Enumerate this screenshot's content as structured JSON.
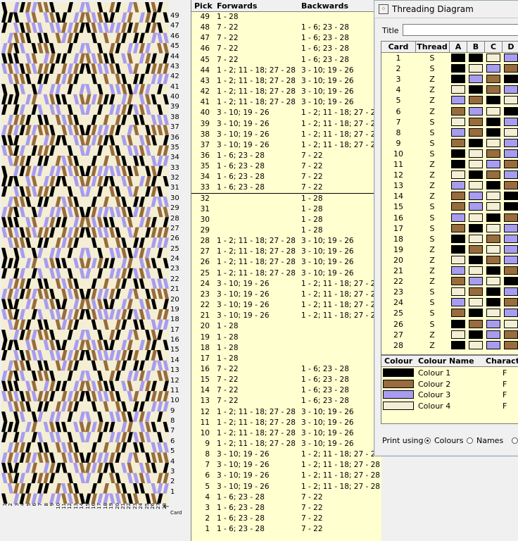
{
  "colours": {
    "c1": "#000000",
    "c2": "#986c3c",
    "c3": "#a89cf0",
    "c4": "#f4efd4"
  },
  "pattern": {
    "pick_ticks": [
      "49",
      "47",
      "46",
      "45",
      "44",
      "43",
      "42",
      "41",
      "40",
      "39",
      "38",
      "37",
      "36",
      "35",
      "34",
      "33",
      "32",
      "31",
      "30",
      "29",
      "28",
      "27",
      "26",
      "25",
      "24",
      "23",
      "22",
      "21",
      "20",
      "19",
      "18",
      "17",
      "16",
      "15",
      "14",
      "13",
      "12",
      "11",
      "10",
      "9",
      "8",
      "7",
      "6",
      "5",
      "4",
      "3",
      "2",
      "1"
    ],
    "card_ticks": [
      "1",
      "2",
      "3",
      "4",
      "5",
      "6",
      "7",
      "8",
      "9",
      "10",
      "11",
      "12",
      "13",
      "14",
      "15",
      "16",
      "17",
      "18",
      "19",
      "20",
      "21",
      "22",
      "23",
      "24",
      "25",
      "26",
      "27",
      "28"
    ],
    "card_label": "Card"
  },
  "schedule": {
    "headers": {
      "pick": "Pick",
      "forwards": "Forwards",
      "backwards": "Backwards"
    },
    "rows": [
      {
        "p": "49",
        "f": "1 - 28",
        "b": ""
      },
      {
        "p": "48",
        "f": "7 - 22",
        "b": "1 - 6; 23 - 28"
      },
      {
        "p": "47",
        "f": "7 - 22",
        "b": "1 - 6; 23 - 28"
      },
      {
        "p": "46",
        "f": "7 - 22",
        "b": "1 - 6; 23 - 28"
      },
      {
        "p": "45",
        "f": "7 - 22",
        "b": "1 - 6; 23 - 28"
      },
      {
        "p": "44",
        "f": "1 - 2; 11 - 18; 27 - 28",
        "b": "3 - 10; 19 - 26"
      },
      {
        "p": "43",
        "f": "1 - 2; 11 - 18; 27 - 28",
        "b": "3 - 10; 19 - 26"
      },
      {
        "p": "42",
        "f": "1 - 2; 11 - 18; 27 - 28",
        "b": "3 - 10; 19 - 26"
      },
      {
        "p": "41",
        "f": "1 - 2; 11 - 18; 27 - 28",
        "b": "3 - 10; 19 - 26"
      },
      {
        "p": "40",
        "f": "3 - 10; 19 - 26",
        "b": "1 - 2; 11 - 18; 27 - 28"
      },
      {
        "p": "39",
        "f": "3 - 10; 19 - 26",
        "b": "1 - 2; 11 - 18; 27 - 28"
      },
      {
        "p": "38",
        "f": "3 - 10; 19 - 26",
        "b": "1 - 2; 11 - 18; 27 - 28"
      },
      {
        "p": "37",
        "f": "3 - 10; 19 - 26",
        "b": "1 - 2; 11 - 18; 27 - 28"
      },
      {
        "p": "36",
        "f": "1 - 6; 23 - 28",
        "b": "7 - 22"
      },
      {
        "p": "35",
        "f": "1 - 6; 23 - 28",
        "b": "7 - 22"
      },
      {
        "p": "34",
        "f": "1 - 6; 23 - 28",
        "b": "7 - 22"
      },
      {
        "p": "33",
        "f": "1 - 6; 23 - 28",
        "b": "7 - 22"
      },
      {
        "p": "32",
        "f": "",
        "b": "1 - 28"
      },
      {
        "p": "31",
        "f": "",
        "b": "1 - 28"
      },
      {
        "p": "30",
        "f": "",
        "b": "1 - 28"
      },
      {
        "p": "29",
        "f": "",
        "b": "1 - 28"
      },
      {
        "p": "28",
        "f": "1 - 2; 11 - 18; 27 - 28",
        "b": "3 - 10; 19 - 26"
      },
      {
        "p": "27",
        "f": "1 - 2; 11 - 18; 27 - 28",
        "b": "3 - 10; 19 - 26"
      },
      {
        "p": "26",
        "f": "1 - 2; 11 - 18; 27 - 28",
        "b": "3 - 10; 19 - 26"
      },
      {
        "p": "25",
        "f": "1 - 2; 11 - 18; 27 - 28",
        "b": "3 - 10; 19 - 26"
      },
      {
        "p": "24",
        "f": "3 - 10; 19 - 26",
        "b": "1 - 2; 11 - 18; 27 - 28"
      },
      {
        "p": "23",
        "f": "3 - 10; 19 - 26",
        "b": "1 - 2; 11 - 18; 27 - 28"
      },
      {
        "p": "22",
        "f": "3 - 10; 19 - 26",
        "b": "1 - 2; 11 - 18; 27 - 28"
      },
      {
        "p": "21",
        "f": "3 - 10; 19 - 26",
        "b": "1 - 2; 11 - 18; 27 - 28"
      },
      {
        "p": "20",
        "f": "1 - 28",
        "b": ""
      },
      {
        "p": "19",
        "f": "1 - 28",
        "b": ""
      },
      {
        "p": "18",
        "f": "1 - 28",
        "b": ""
      },
      {
        "p": "17",
        "f": "1 - 28",
        "b": ""
      },
      {
        "p": "16",
        "f": "7 - 22",
        "b": "1 - 6; 23 - 28"
      },
      {
        "p": "15",
        "f": "7 - 22",
        "b": "1 - 6; 23 - 28"
      },
      {
        "p": "14",
        "f": "7 - 22",
        "b": "1 - 6; 23 - 28"
      },
      {
        "p": "13",
        "f": "7 - 22",
        "b": "1 - 6; 23 - 28"
      },
      {
        "p": "12",
        "f": "1 - 2; 11 - 18; 27 - 28",
        "b": "3 - 10; 19 - 26"
      },
      {
        "p": "11",
        "f": "1 - 2; 11 - 18; 27 - 28",
        "b": "3 - 10; 19 - 26"
      },
      {
        "p": "10",
        "f": "1 - 2; 11 - 18; 27 - 28",
        "b": "3 - 10; 19 - 26"
      },
      {
        "p": "9",
        "f": "1 - 2; 11 - 18; 27 - 28",
        "b": "3 - 10; 19 - 26"
      },
      {
        "p": "8",
        "f": "3 - 10; 19 - 26",
        "b": "1 - 2; 11 - 18; 27 - 28"
      },
      {
        "p": "7",
        "f": "3 - 10; 19 - 26",
        "b": "1 - 2; 11 - 18; 27 - 28"
      },
      {
        "p": "6",
        "f": "3 - 10; 19 - 26",
        "b": "1 - 2; 11 - 18; 27 - 28"
      },
      {
        "p": "5",
        "f": "3 - 10; 19 - 26",
        "b": "1 - 2; 11 - 18; 27 - 28"
      },
      {
        "p": "4",
        "f": "1 - 6; 23 - 28",
        "b": "7 - 22"
      },
      {
        "p": "3",
        "f": "1 - 6; 23 - 28",
        "b": "7 - 22"
      },
      {
        "p": "2",
        "f": "1 - 6; 23 - 28",
        "b": "7 - 22"
      },
      {
        "p": "1",
        "f": "1 - 6; 23 - 28",
        "b": "7 - 22"
      }
    ]
  },
  "threading": {
    "window_title": "Threading Diagram",
    "title_label": "Title",
    "title_value": "",
    "headers": {
      "card": "Card",
      "thread": "Thread",
      "a": "A",
      "b": "B",
      "c": "C",
      "d": "D"
    },
    "cards": [
      {
        "n": "1",
        "t": "S",
        "h": [
          1,
          1,
          4,
          3
        ]
      },
      {
        "n": "2",
        "t": "S",
        "h": [
          1,
          4,
          3,
          2
        ]
      },
      {
        "n": "3",
        "t": "Z",
        "h": [
          1,
          3,
          2,
          1
        ]
      },
      {
        "n": "4",
        "t": "Z",
        "h": [
          4,
          1,
          2,
          3
        ]
      },
      {
        "n": "5",
        "t": "Z",
        "h": [
          3,
          2,
          1,
          4
        ]
      },
      {
        "n": "6",
        "t": "Z",
        "h": [
          2,
          3,
          4,
          1
        ]
      },
      {
        "n": "7",
        "t": "S",
        "h": [
          4,
          2,
          1,
          3
        ]
      },
      {
        "n": "8",
        "t": "S",
        "h": [
          3,
          2,
          1,
          4
        ]
      },
      {
        "n": "9",
        "t": "S",
        "h": [
          2,
          1,
          4,
          3
        ]
      },
      {
        "n": "10",
        "t": "S",
        "h": [
          1,
          4,
          2,
          3
        ]
      },
      {
        "n": "11",
        "t": "Z",
        "h": [
          1,
          4,
          3,
          2
        ]
      },
      {
        "n": "12",
        "t": "Z",
        "h": [
          4,
          1,
          2,
          3
        ]
      },
      {
        "n": "13",
        "t": "Z",
        "h": [
          3,
          4,
          1,
          2
        ]
      },
      {
        "n": "14",
        "t": "Z",
        "h": [
          2,
          3,
          4,
          1
        ]
      },
      {
        "n": "15",
        "t": "S",
        "h": [
          2,
          3,
          4,
          1
        ]
      },
      {
        "n": "16",
        "t": "S",
        "h": [
          3,
          4,
          1,
          2
        ]
      },
      {
        "n": "17",
        "t": "S",
        "h": [
          2,
          1,
          4,
          3
        ]
      },
      {
        "n": "18",
        "t": "S",
        "h": [
          1,
          4,
          2,
          3
        ]
      },
      {
        "n": "19",
        "t": "Z",
        "h": [
          1,
          2,
          4,
          3
        ]
      },
      {
        "n": "20",
        "t": "Z",
        "h": [
          4,
          1,
          2,
          3
        ]
      },
      {
        "n": "21",
        "t": "Z",
        "h": [
          3,
          4,
          1,
          2
        ]
      },
      {
        "n": "22",
        "t": "Z",
        "h": [
          2,
          3,
          4,
          1
        ]
      },
      {
        "n": "23",
        "t": "S",
        "h": [
          4,
          2,
          1,
          3
        ]
      },
      {
        "n": "24",
        "t": "S",
        "h": [
          3,
          4,
          1,
          2
        ]
      },
      {
        "n": "25",
        "t": "S",
        "h": [
          2,
          1,
          4,
          3
        ]
      },
      {
        "n": "26",
        "t": "S",
        "h": [
          1,
          2,
          3,
          4
        ]
      },
      {
        "n": "27",
        "t": "Z",
        "h": [
          4,
          1,
          3,
          2
        ]
      },
      {
        "n": "28",
        "t": "Z",
        "h": [
          1,
          4,
          3,
          2
        ]
      }
    ],
    "colour_headers": {
      "colour": "Colour",
      "name": "Colour Name",
      "char": "Characte"
    },
    "colour_list": [
      {
        "key": "c1",
        "name": "Colour 1",
        "char": "F"
      },
      {
        "key": "c2",
        "name": "Colour 2",
        "char": "F"
      },
      {
        "key": "c3",
        "name": "Colour 3",
        "char": "F"
      },
      {
        "key": "c4",
        "name": "Colour 4",
        "char": "F"
      }
    ],
    "print_label": "Print using",
    "print_options": [
      {
        "label": "Colours",
        "selected": true
      },
      {
        "label": "Names",
        "selected": false
      }
    ]
  }
}
